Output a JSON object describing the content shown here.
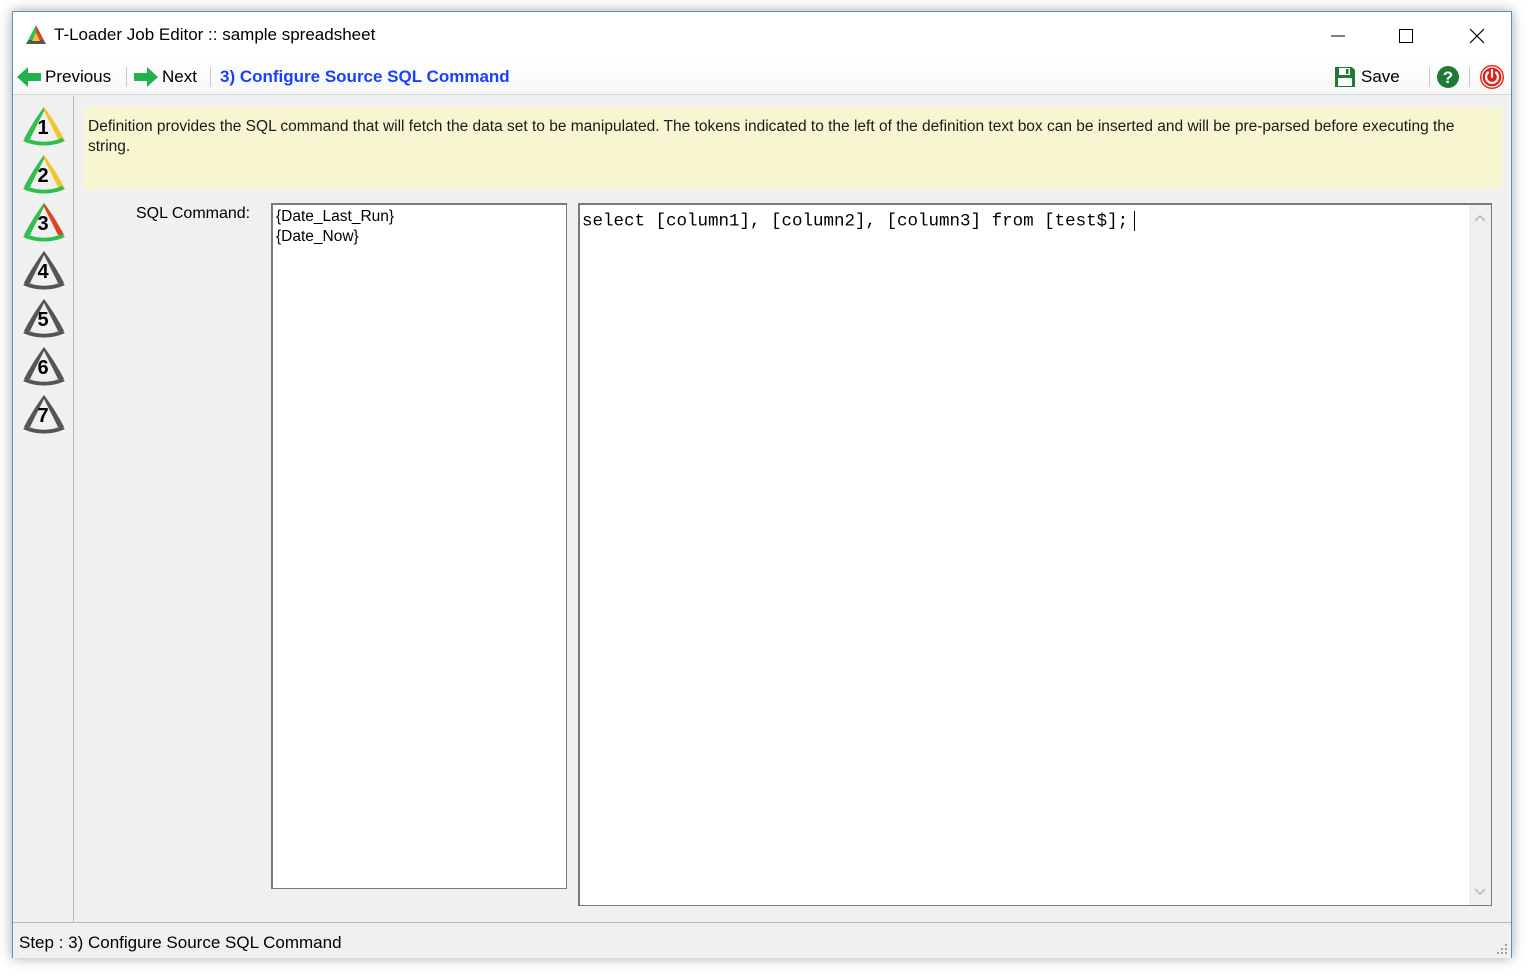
{
  "window": {
    "title": "T-Loader Job Editor :: sample spreadsheet"
  },
  "toolbar": {
    "previous_label": "Previous",
    "next_label": "Next",
    "step_title": "3) Configure Source SQL Command",
    "save_label": "Save"
  },
  "steps": [
    {
      "number": "1",
      "status": "complete"
    },
    {
      "number": "2",
      "status": "complete"
    },
    {
      "number": "3",
      "status": "current"
    },
    {
      "number": "4",
      "status": "pending"
    },
    {
      "number": "5",
      "status": "pending"
    },
    {
      "number": "6",
      "status": "pending"
    },
    {
      "number": "7",
      "status": "pending"
    }
  ],
  "content": {
    "description": "Definition provides the SQL command that will fetch the data set to be manipulated. The tokens indicated to the left of the definition text box can be inserted and will be pre-parsed before executing the string.",
    "sql_label": "SQL Command:",
    "tokens": [
      "{Date_Last_Run}",
      "{Date_Now}"
    ],
    "sql_value": "select [column1], [column2], [column3] from [test$];"
  },
  "status": {
    "text": "Step : 3) Configure Source SQL Command"
  },
  "colors": {
    "description_bg": "#f7f6d0",
    "step_title": "#1a3fff",
    "arrow_green": "#22b14c",
    "help_green": "#1e7b34",
    "power_red": "#e0201b",
    "step_green": "#2fbf4a",
    "step_yellow": "#f2c530",
    "step_red": "#d9452b",
    "step_gray": "#555555"
  },
  "icons": {
    "app": "t-loader-triangle-icon",
    "previous": "arrow-left-icon",
    "next": "arrow-right-icon",
    "save": "floppy-disk-icon",
    "help": "help-icon",
    "exit": "power-icon"
  }
}
